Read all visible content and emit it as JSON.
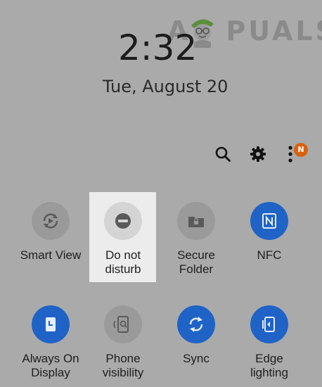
{
  "watermark": {
    "text": "APPUALS",
    "left": "A",
    "right": "PUALS"
  },
  "lockscreen": {
    "time": "2:32",
    "date": "Tue, August 20"
  },
  "header": {
    "search_icon": "search-icon",
    "settings_icon": "gear-icon",
    "more_icon": "more-vertical-icon",
    "badge": "N"
  },
  "tiles": [
    {
      "label_line1": "Smart View",
      "label_line2": "",
      "icon": "smart-view-icon",
      "state": "off"
    },
    {
      "label_line1": "Do not",
      "label_line2": "disturb",
      "icon": "minus-circle-icon",
      "state": "highlighted"
    },
    {
      "label_line1": "Secure",
      "label_line2": "Folder",
      "icon": "folder-lock-icon",
      "state": "off"
    },
    {
      "label_line1": "NFC",
      "label_line2": "",
      "icon": "nfc-icon",
      "state": "on"
    },
    {
      "label_line1": "Always On",
      "label_line2": "Display",
      "icon": "clock-display-icon",
      "state": "on"
    },
    {
      "label_line1": "Phone",
      "label_line2": "visibility",
      "icon": "phone-search-icon",
      "state": "off"
    },
    {
      "label_line1": "Sync",
      "label_line2": "",
      "icon": "sync-icon",
      "state": "on"
    },
    {
      "label_line1": "Edge",
      "label_line2": "lighting",
      "icon": "edge-lighting-icon",
      "state": "on"
    }
  ],
  "colors": {
    "background": "#aaaaaa",
    "active_tile": "#1f63c7",
    "inactive_tile": "#9a9a9a",
    "badge": "#d9620f"
  }
}
